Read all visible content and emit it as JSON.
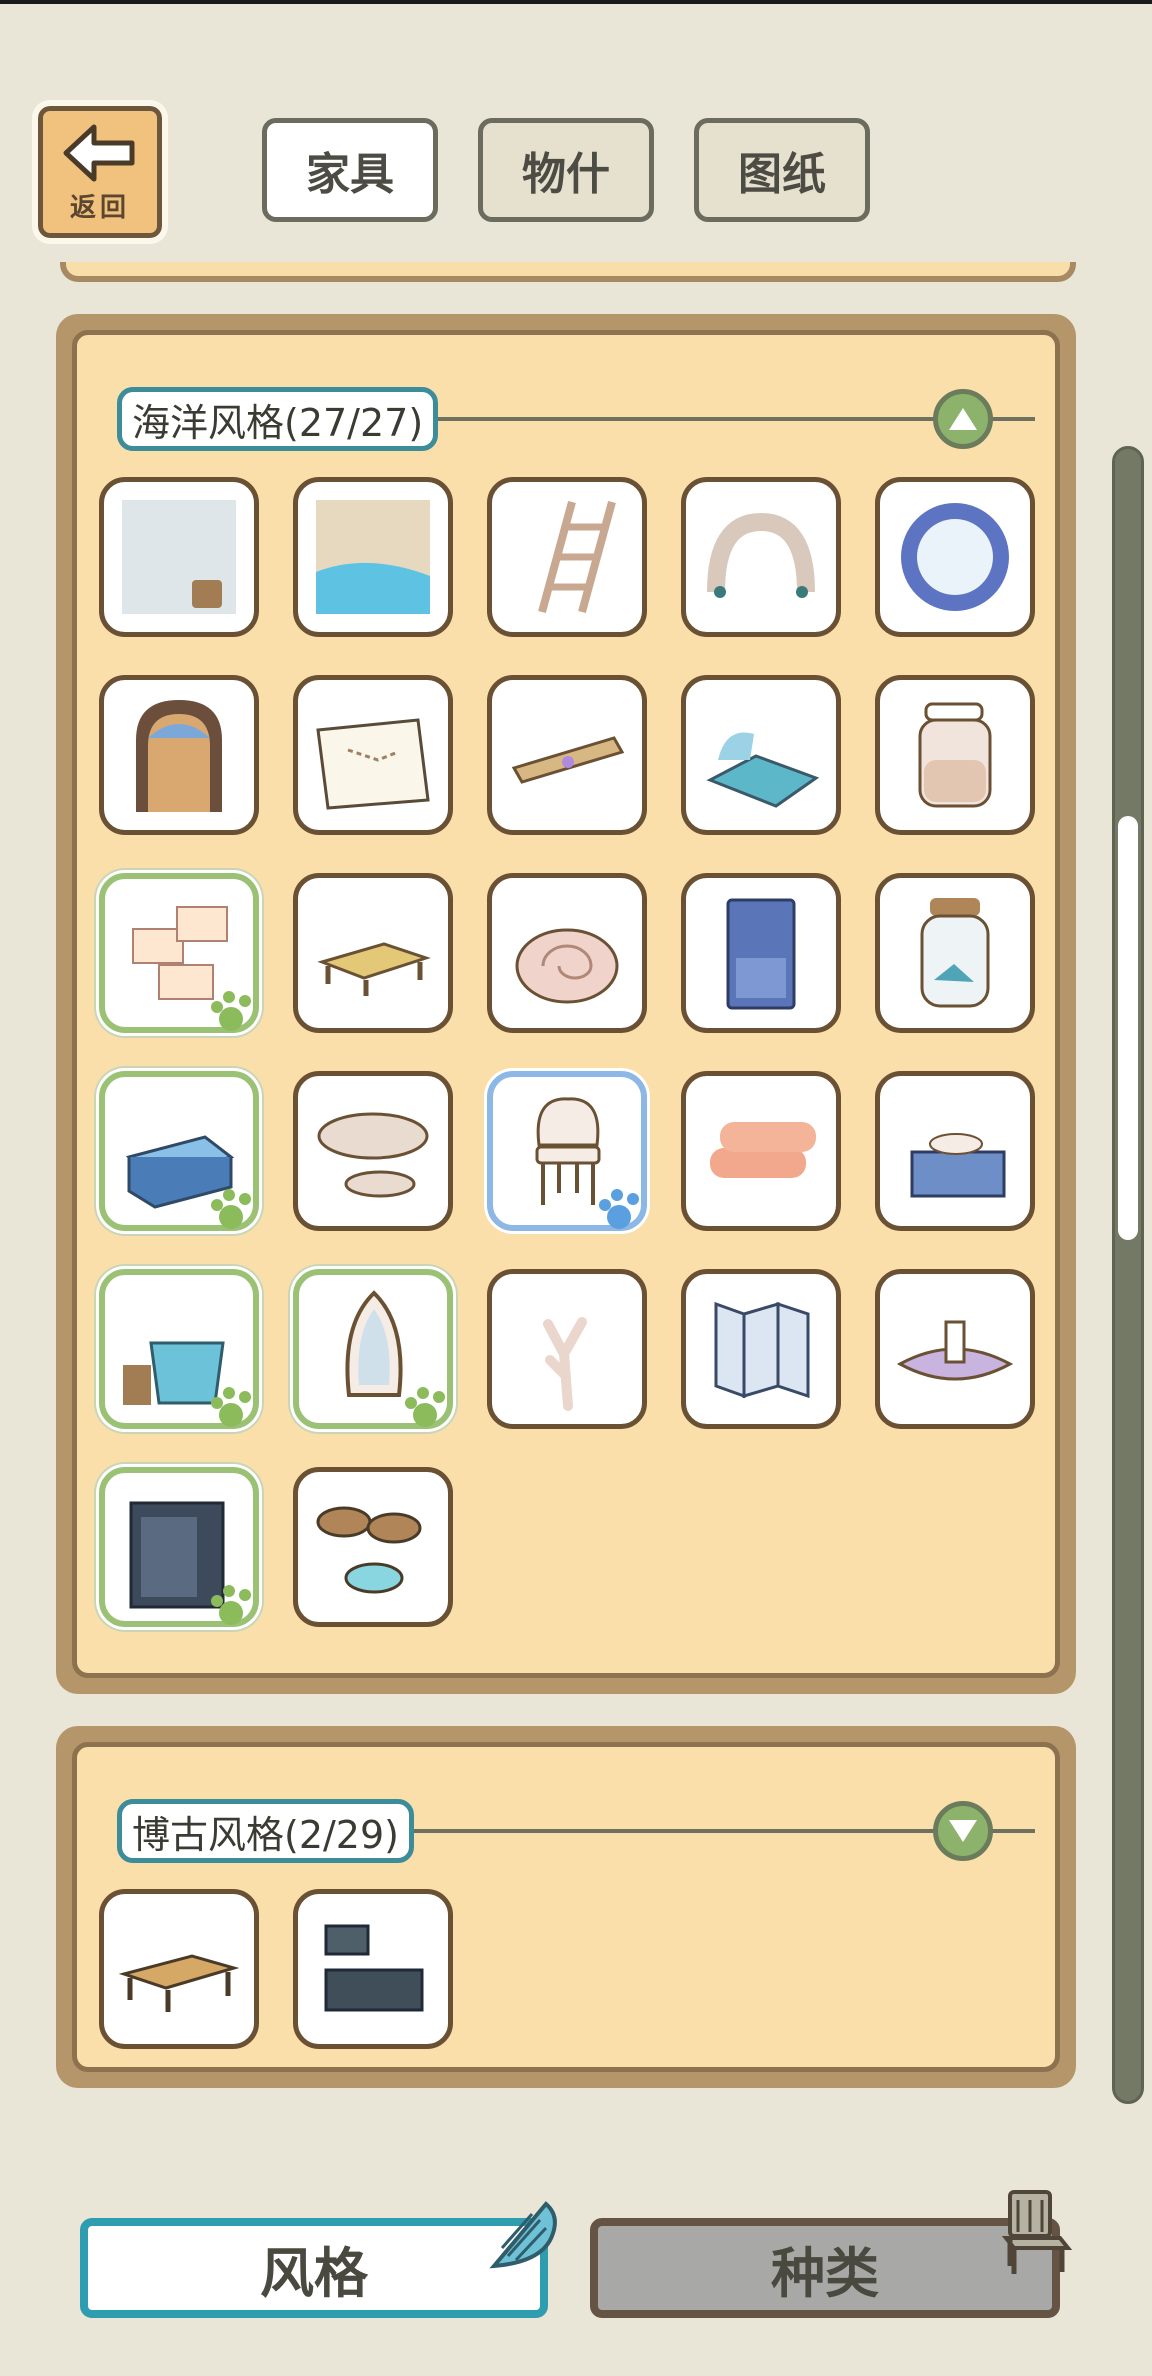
{
  "header": {
    "back_label": "返回",
    "tabs": [
      {
        "label": "家具",
        "active": true
      },
      {
        "label": "物什",
        "active": false
      },
      {
        "label": "图纸",
        "active": false
      }
    ]
  },
  "sections": [
    {
      "title": "海洋风格(27/27)",
      "expanded": true,
      "items": [
        {
          "icon": "wall-with-bucket-icon",
          "state": "normal"
        },
        {
          "icon": "seaside-floor-icon",
          "state": "normal"
        },
        {
          "icon": "ladder-icon",
          "state": "normal"
        },
        {
          "icon": "stone-arch-icon",
          "state": "normal"
        },
        {
          "icon": "porthole-window-icon",
          "state": "normal"
        },
        {
          "icon": "arched-door-icon",
          "state": "normal"
        },
        {
          "icon": "treasure-map-icon",
          "state": "normal"
        },
        {
          "icon": "scroll-icon",
          "state": "normal"
        },
        {
          "icon": "shell-bed-icon",
          "state": "normal"
        },
        {
          "icon": "sand-jar-icon",
          "state": "normal"
        },
        {
          "icon": "memo-board-icon",
          "state": "new"
        },
        {
          "icon": "low-table-icon",
          "state": "normal"
        },
        {
          "icon": "conch-seat-icon",
          "state": "normal"
        },
        {
          "icon": "blue-cabinet-icon",
          "state": "normal"
        },
        {
          "icon": "shell-jar-icon",
          "state": "normal"
        },
        {
          "icon": "treasure-chest-icon",
          "state": "new"
        },
        {
          "icon": "rock-table-icon",
          "state": "normal"
        },
        {
          "icon": "shell-chair-icon",
          "state": "selected"
        },
        {
          "icon": "towel-rolls-icon",
          "state": "normal"
        },
        {
          "icon": "vanity-desk-icon",
          "state": "normal"
        },
        {
          "icon": "water-basin-icon",
          "state": "new"
        },
        {
          "icon": "surfboard-mirror-icon",
          "state": "new"
        },
        {
          "icon": "coral-icon",
          "state": "normal"
        },
        {
          "icon": "folding-screen-icon",
          "state": "normal"
        },
        {
          "icon": "shell-candle-icon",
          "state": "normal"
        },
        {
          "icon": "anchor-cabinet-icon",
          "state": "new"
        },
        {
          "icon": "barrel-stools-icon",
          "state": "normal"
        }
      ]
    },
    {
      "title": "博古风格(2/29)",
      "expanded": false,
      "items": [
        {
          "icon": "antique-table-icon",
          "state": "normal"
        },
        {
          "icon": "antique-stove-icon",
          "state": "normal"
        }
      ]
    }
  ],
  "bottom_tabs": [
    {
      "label": "风格",
      "active": true,
      "icon": "conch-shell-icon"
    },
    {
      "label": "种类",
      "active": false,
      "icon": "chair-icon"
    }
  ],
  "colors": {
    "background": "#e9e6d7",
    "panel_fill": "#fadfab",
    "panel_border": "#b5966b",
    "accent_teal": "#2f9db0",
    "new_green": "#9bc274",
    "selected_blue": "#8db8e6"
  }
}
